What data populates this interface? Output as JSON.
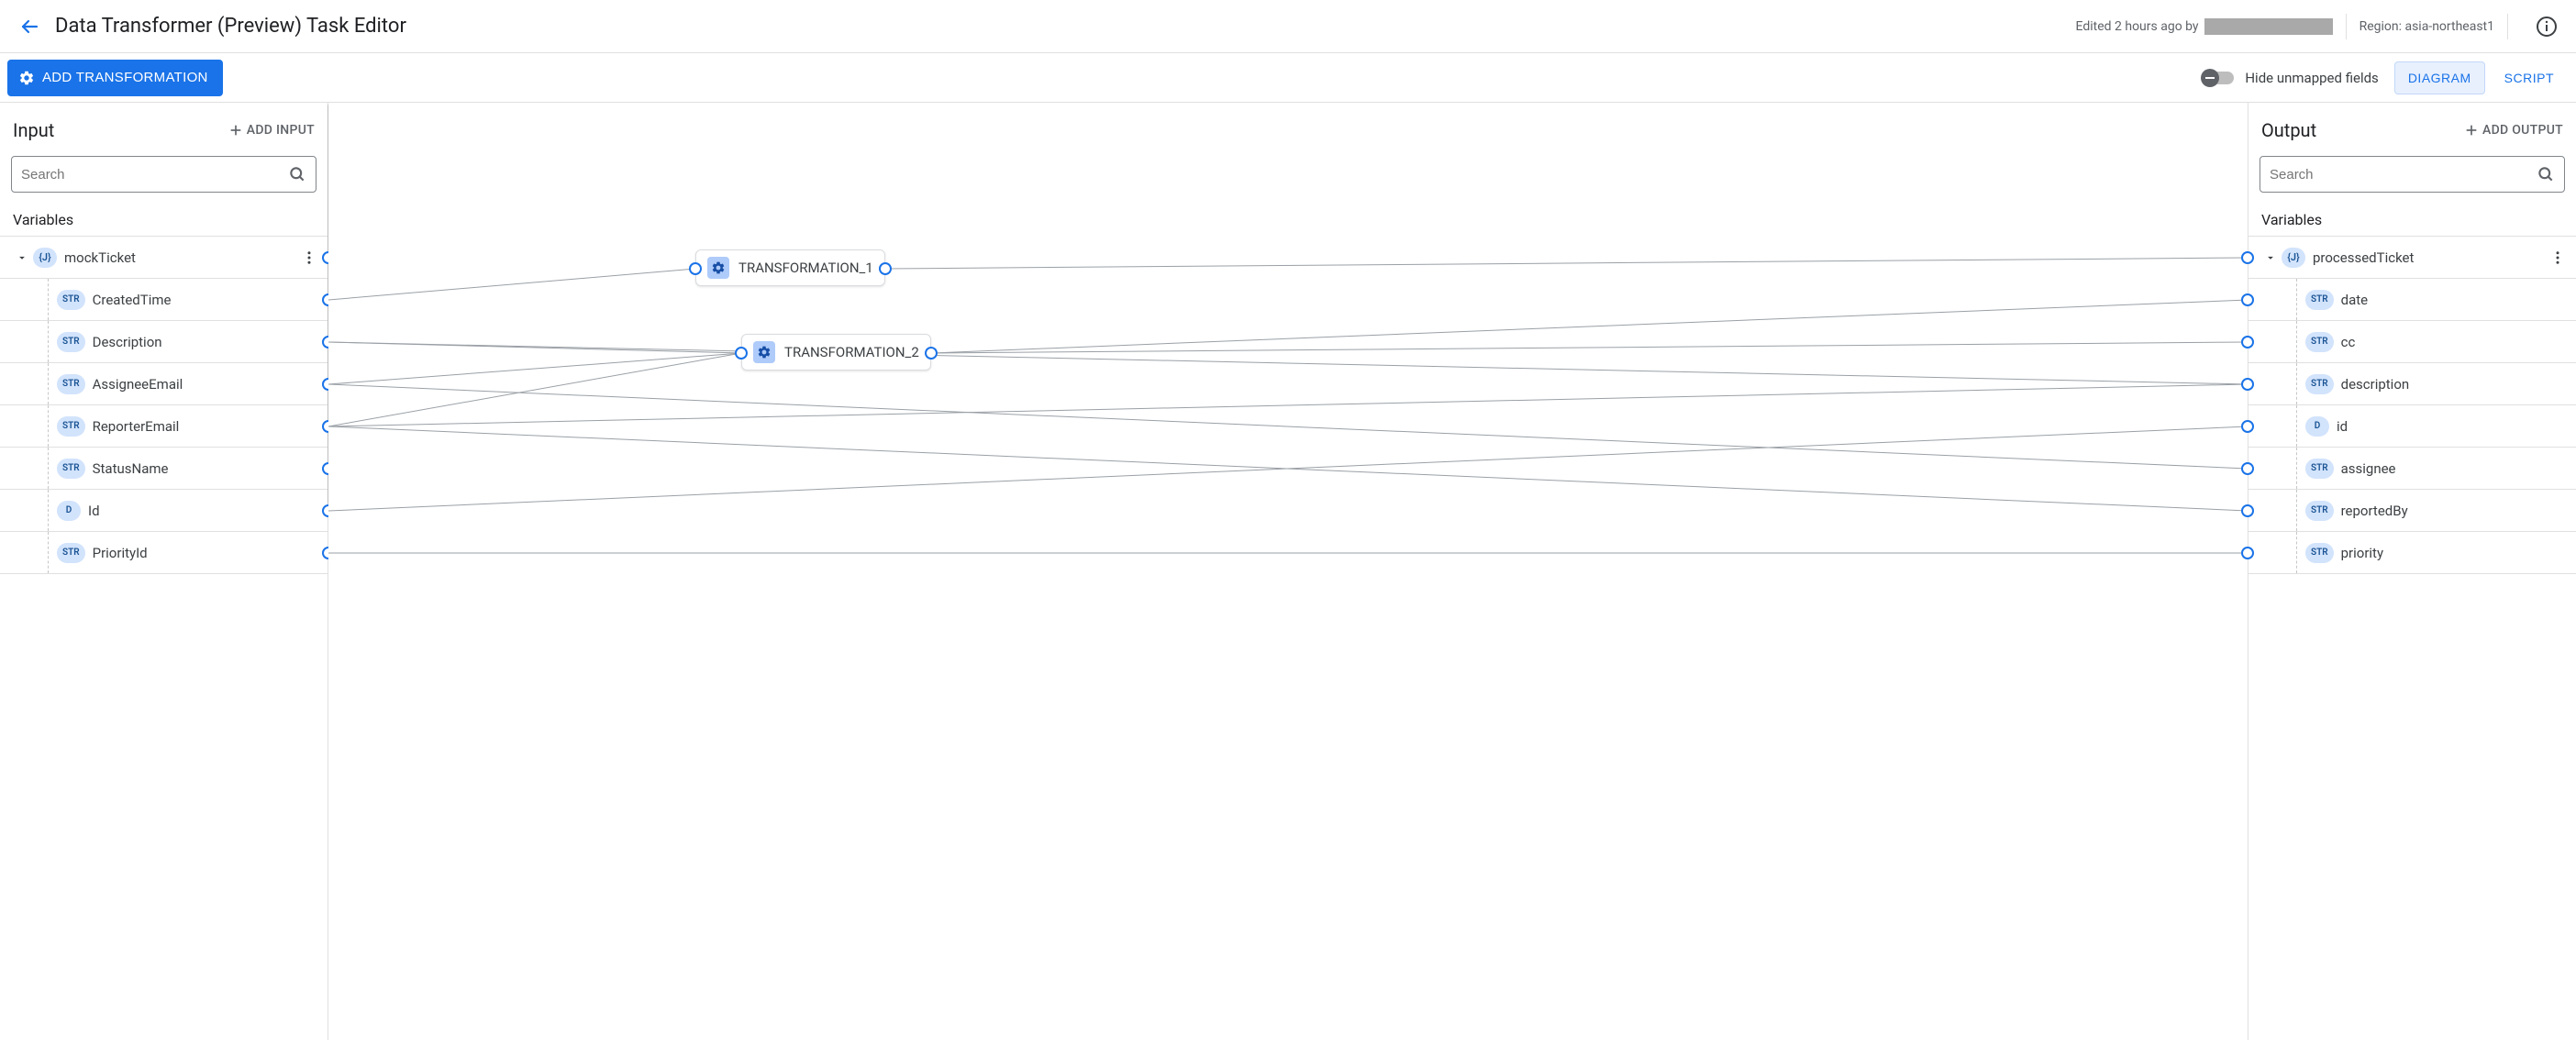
{
  "header": {
    "title": "Data Transformer (Preview) Task Editor",
    "edited_prefix": "Edited 2 hours ago by",
    "region_label": "Region: asia-northeast1"
  },
  "toolbar": {
    "add_transformation": "ADD TRANSFORMATION",
    "hide_unmapped": "Hide unmapped fields",
    "tab_diagram": "DIAGRAM",
    "tab_script": "SCRIPT"
  },
  "input_panel": {
    "title": "Input",
    "add_label": "ADD INPUT",
    "search_placeholder": "Search",
    "section": "Variables",
    "root": {
      "type": "{J}",
      "name": "mockTicket"
    },
    "fields": [
      {
        "type": "STR",
        "name": "CreatedTime"
      },
      {
        "type": "STR",
        "name": "Description"
      },
      {
        "type": "STR",
        "name": "AssigneeEmail"
      },
      {
        "type": "STR",
        "name": "ReporterEmail"
      },
      {
        "type": "STR",
        "name": "StatusName"
      },
      {
        "type": "D",
        "name": "Id"
      },
      {
        "type": "STR",
        "name": "PriorityId"
      }
    ]
  },
  "output_panel": {
    "title": "Output",
    "add_label": "ADD OUTPUT",
    "search_placeholder": "Search",
    "section": "Variables",
    "root": {
      "type": "{J}",
      "name": "processedTicket"
    },
    "fields": [
      {
        "type": "STR",
        "name": "date"
      },
      {
        "type": "STR",
        "name": "cc"
      },
      {
        "type": "STR",
        "name": "description"
      },
      {
        "type": "D",
        "name": "id"
      },
      {
        "type": "STR",
        "name": "assignee"
      },
      {
        "type": "STR",
        "name": "reportedBy"
      },
      {
        "type": "STR",
        "name": "priority"
      }
    ]
  },
  "nodes": {
    "t1": "TRANSFORMATION_1",
    "t2": "TRANSFORMATION_2"
  }
}
